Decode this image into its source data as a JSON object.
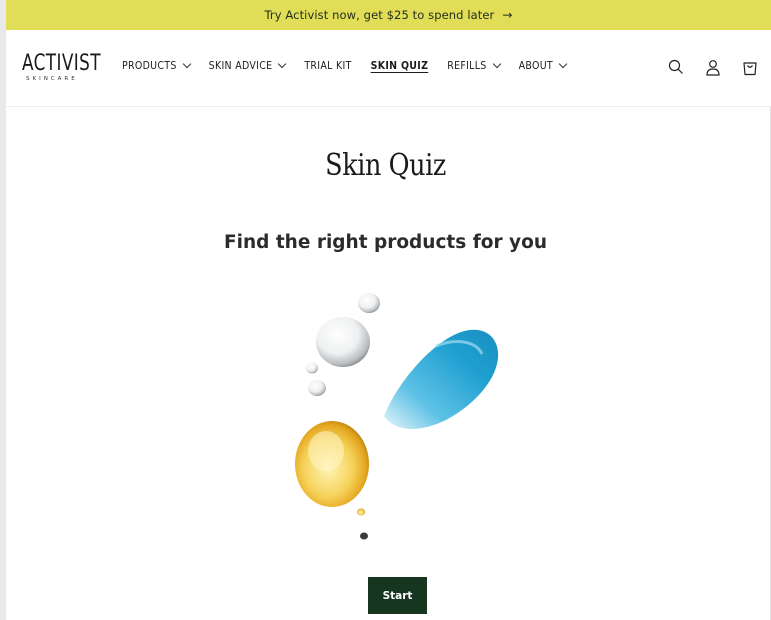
{
  "announcement": {
    "text": "Try Activist now, get $25 to spend later",
    "arrow": "→"
  },
  "logo": {
    "main": "ACTIVIST",
    "sub": "SKINCARE"
  },
  "nav": {
    "items": [
      {
        "label": "PRODUCTS",
        "dropdown": true
      },
      {
        "label": "SKIN ADVICE",
        "dropdown": true
      },
      {
        "label": "TRIAL KIT",
        "dropdown": false
      },
      {
        "label": "SKIN QUIZ",
        "dropdown": false,
        "active": true
      },
      {
        "label": "REFILLS",
        "dropdown": true
      },
      {
        "label": "ABOUT",
        "dropdown": true
      }
    ]
  },
  "header_icons": [
    "search-icon",
    "account-icon",
    "cart-icon"
  ],
  "page": {
    "title": "Skin Quiz",
    "subtitle": "Find the right products for you",
    "start_label": "Start"
  },
  "colors": {
    "announcement_bg": "#e1dd56",
    "button_bg": "#17361f",
    "serum_blue": "#2aa9d6",
    "oil_gold": "#e9b52a"
  }
}
